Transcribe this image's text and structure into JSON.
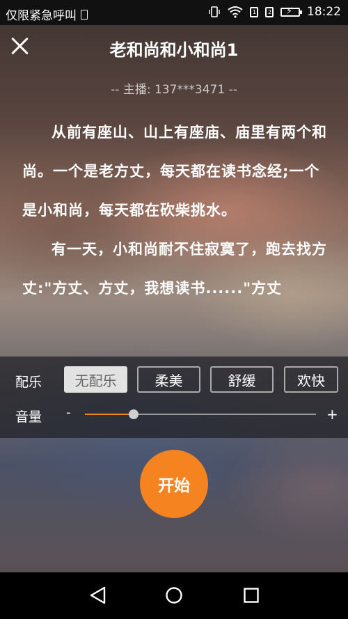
{
  "statusbar": {
    "carrier": "仅限紧急呼叫",
    "time": "18:22",
    "sim1": "1",
    "sim2": "2"
  },
  "header": {
    "title": "老和尚和小和尚1"
  },
  "host": "-- 主播: 137***3471 --",
  "story": {
    "paragraphs": [
      "从前有座山、山上有座庙、庙里有两个和尚。一个是老方丈，每天都在读书念经;一个是小和尚，每天都在砍柴挑水。",
      "有一天，小和尚耐不住寂寞了，跑去找方丈:\"方丈、方丈，我想读书......\"方丈"
    ]
  },
  "music": {
    "label": "配乐",
    "options": [
      "无配乐",
      "柔美",
      "舒缓",
      "欢快"
    ],
    "selected": "无配乐"
  },
  "volume": {
    "label": "音量",
    "minus": "-",
    "plus": "+",
    "level": 0.21
  },
  "start_label": "开始",
  "colors": {
    "accent": "#f5831f",
    "active_option_bg": "#e2e2e2"
  }
}
